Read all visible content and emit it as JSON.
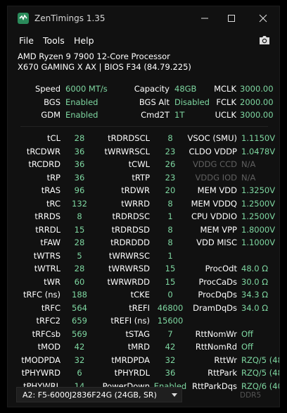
{
  "window": {
    "title": "ZenTimings 1.35"
  },
  "menu": {
    "file": "File",
    "tools": "Tools",
    "help": "Help"
  },
  "system": {
    "cpu": "AMD Ryzen 9 7900 12-Core Processor",
    "board": "X670 GAMING X AX | BIOS F34 (84.79.225)"
  },
  "top": [
    {
      "l1": "Speed",
      "v1": "6000 MT/s",
      "l2": "Capacity",
      "v2": "48GB",
      "l3": "MCLK",
      "v3": "3000.00"
    },
    {
      "l1": "BGS",
      "v1": "Enabled",
      "l2": "BGS Alt",
      "v2": "Disabled",
      "l3": "FCLK",
      "v3": "2000.00"
    },
    {
      "l1": "GDM",
      "v1": "Enabled",
      "l2": "Cmd2T",
      "v2": "1T",
      "l3": "UCLK",
      "v3": "3000.00"
    }
  ],
  "timings": [
    {
      "l1": "tCL",
      "v1": "28",
      "l2": "tRDRDSCL",
      "v2": "8",
      "l3": "VSOC (SMU)",
      "v3": "1.1150V"
    },
    {
      "l1": "tRCDWR",
      "v1": "36",
      "l2": "tWRWRSCL",
      "v2": "23",
      "l3": "CLDO VDDP",
      "v3": "1.0478V"
    },
    {
      "l1": "tRCDRD",
      "v1": "36",
      "l2": "tCWL",
      "v2": "26",
      "l3": "VDDG CCD",
      "v3": "N/A",
      "dim": true
    },
    {
      "l1": "tRP",
      "v1": "36",
      "l2": "tRTP",
      "v2": "23",
      "l3": "VDDG IOD",
      "v3": "N/A",
      "dim": true
    },
    {
      "l1": "tRAS",
      "v1": "96",
      "l2": "tRDWR",
      "v2": "20",
      "l3": "MEM VDD",
      "v3": "1.3250V"
    },
    {
      "l1": "tRC",
      "v1": "132",
      "l2": "tWRRD",
      "v2": "8",
      "l3": "MEM VDDQ",
      "v3": "1.2500V"
    },
    {
      "l1": "tRRDS",
      "v1": "8",
      "l2": "tRDRDSC",
      "v2": "1",
      "l3": "CPU VDDIO",
      "v3": "1.2500V"
    },
    {
      "l1": "tRRDL",
      "v1": "15",
      "l2": "tRDRDSD",
      "v2": "8",
      "l3": "MEM VPP",
      "v3": "1.8000V"
    },
    {
      "l1": "tFAW",
      "v1": "28",
      "l2": "tRDRDDD",
      "v2": "8",
      "l3": "VDD MISC",
      "v3": "1.1000V"
    },
    {
      "l1": "tWTRS",
      "v1": "5",
      "l2": "tWRWRSC",
      "v2": "1",
      "l3": "",
      "v3": ""
    },
    {
      "l1": "tWTRL",
      "v1": "28",
      "l2": "tWRWRSD",
      "v2": "15",
      "l3": "ProcOdt",
      "v3": "48.0 Ω"
    },
    {
      "l1": "tWR",
      "v1": "60",
      "l2": "tWRWRDD",
      "v2": "15",
      "l3": "ProcCaDs",
      "v3": "30.0 Ω"
    },
    {
      "l1": "tRFC (ns)",
      "v1": "188",
      "l2": "tCKE",
      "v2": "0",
      "l3": "ProcDqDs",
      "v3": "34.3 Ω"
    },
    {
      "l1": "tRFC",
      "v1": "564",
      "l2": "tREFI",
      "v2": "46800",
      "l3": "DramDqDs",
      "v3": "34.0 Ω"
    },
    {
      "l1": "tRFC2",
      "v1": "659",
      "l2": "tREFI (ns)",
      "v2": "15600",
      "l3": "",
      "v3": ""
    },
    {
      "l1": "tRFCsb",
      "v1": "569",
      "l2": "tSTAG",
      "v2": "7",
      "l3": "RttNomWr",
      "v3": "Off"
    },
    {
      "l1": "tMOD",
      "v1": "42",
      "l2": "tMRD",
      "v2": "42",
      "l3": "RttNomRd",
      "v3": "Off"
    },
    {
      "l1": "tMODPDA",
      "v1": "32",
      "l2": "tMRDPDA",
      "v2": "32",
      "l3": "RttWr",
      "v3": "RZQ/5 (48)"
    },
    {
      "l1": "tPHYWRD",
      "v1": "6",
      "l2": "tPHYRDL",
      "v2": "36",
      "l3": "RttPark",
      "v3": "RZQ/5 (48)"
    },
    {
      "l1": "tPHYWRL",
      "v1": "14",
      "l2": "PowerDown",
      "v2": "Enabled",
      "l3": "RttParkDqs",
      "v3": "RZQ/6 (40)"
    }
  ],
  "footer": {
    "module": "A2: F5-6000J2836F24G (24GB, SR)",
    "mem_type": "DDR5"
  },
  "colors": {
    "value": "#7ed7a1",
    "label": "#ffffff",
    "disabled": "#606060",
    "background": "#111111"
  },
  "icons": {
    "app": "zentimings-logo-icon",
    "minimize": "minimize-icon",
    "maximize": "maximize-icon",
    "close": "close-icon",
    "screenshot": "camera-icon",
    "dropdown": "chevron-down-icon"
  }
}
